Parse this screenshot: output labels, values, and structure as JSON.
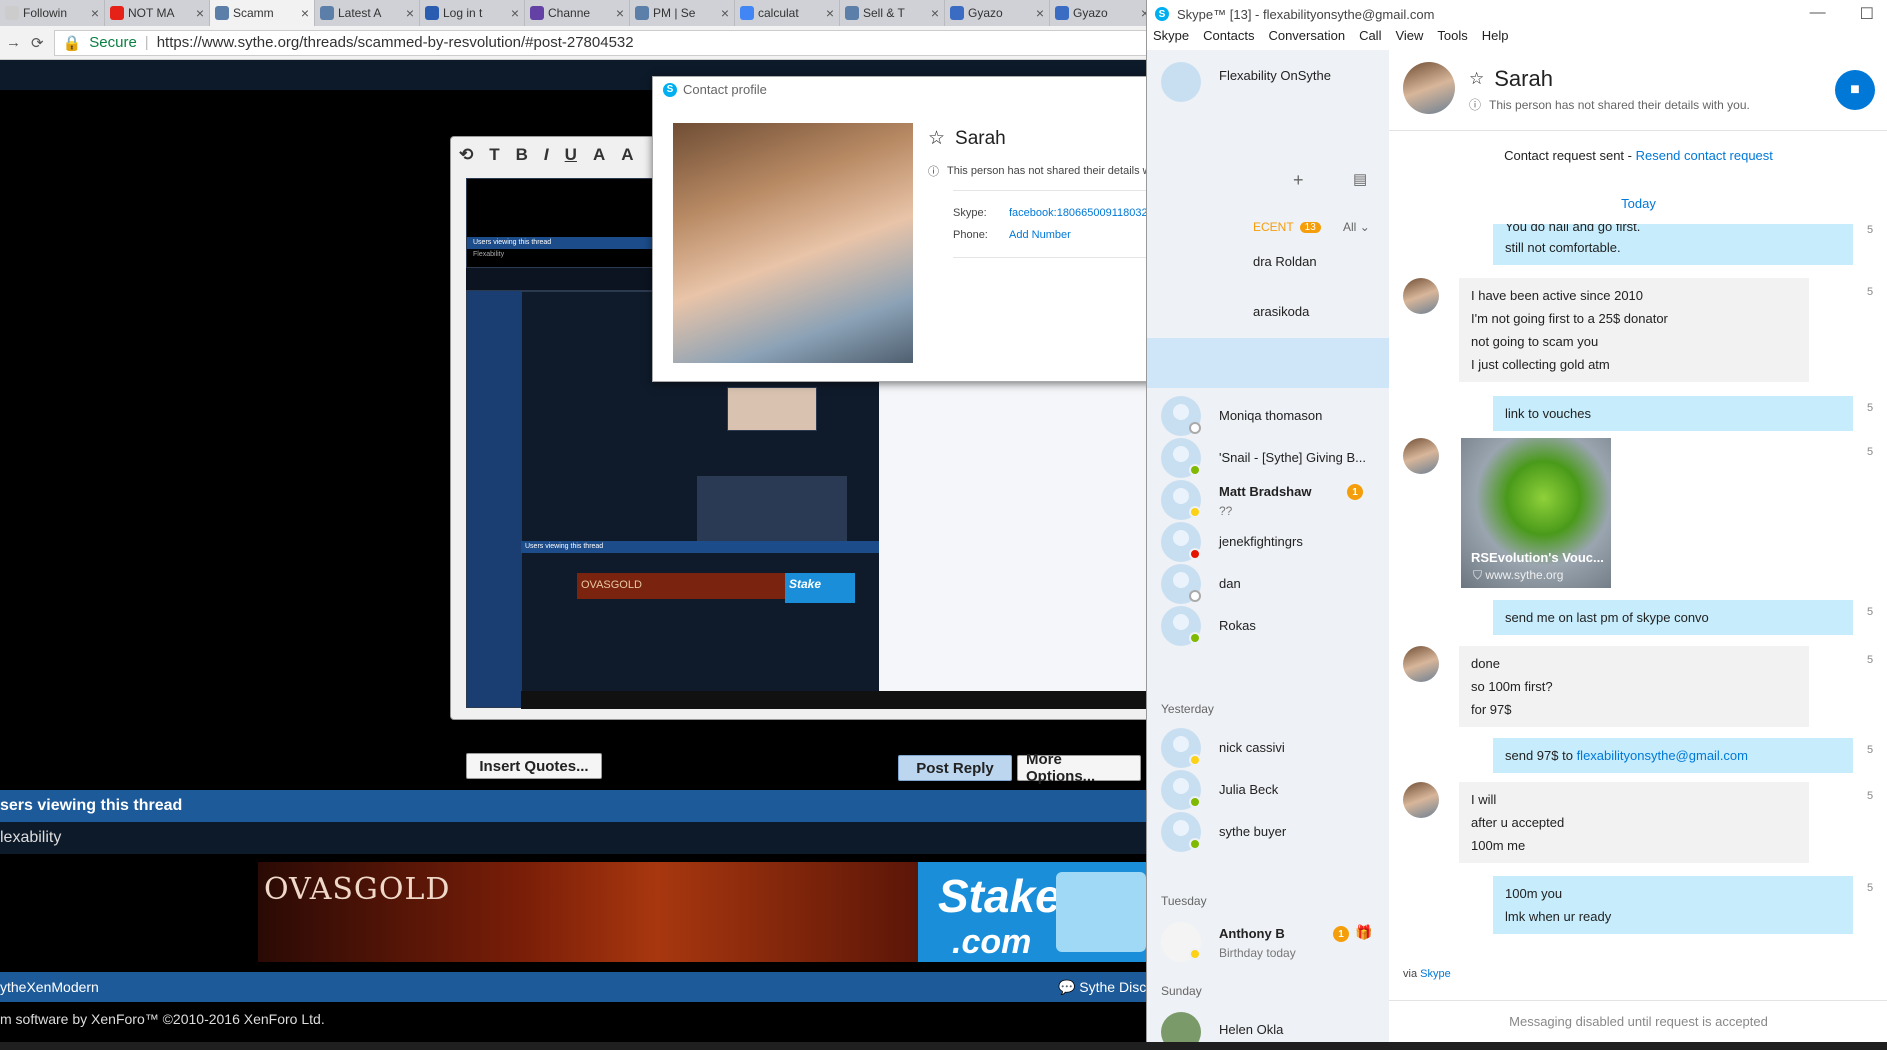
{
  "browser": {
    "tabs": [
      {
        "label": "Followin",
        "color": "#cccccc"
      },
      {
        "label": "NOT MA",
        "color": "#e62117"
      },
      {
        "label": "Scamm",
        "color": "#5b7fa8",
        "active": true
      },
      {
        "label": "Latest A",
        "color": "#5b7fa8"
      },
      {
        "label": "Log in t",
        "color": "#2a5db0"
      },
      {
        "label": "Channe",
        "color": "#6441a5"
      },
      {
        "label": "PM | Se",
        "color": "#5b7fa8"
      },
      {
        "label": "calculat",
        "color": "#4285f4"
      },
      {
        "label": "Sell & T",
        "color": "#5b7fa8"
      },
      {
        "label": "Gyazo",
        "color": "#3a6cc4"
      },
      {
        "label": "Gyazo",
        "color": "#3a6cc4"
      }
    ],
    "secure_label": "Secure",
    "url": "https://www.sythe.org/threads/scammed-by-resvolution/#post-27804532"
  },
  "forum": {
    "insert_quotes": "Insert Quotes...",
    "post_reply": "Post Reply",
    "more_options": "More Options...",
    "viewing_title": "sers viewing this thread",
    "viewers": "lexability",
    "ad_ovas": "OVASGOLD",
    "ad_stake_1": "Stake",
    "ad_stake_2": ".com",
    "footer_left": "ytheXenModern",
    "footer_right": "Sythe Disco",
    "copyright": "m software by XenForo™ ©2010-2016 XenForo Ltd.",
    "nested_viewing": "Users viewing this thread",
    "nested_viewers": "Flexability"
  },
  "profile": {
    "title": "Contact profile",
    "name": "Sarah",
    "notice": "This person has not shared their details with you.",
    "skype_label": "Skype:",
    "skype_value": "facebook:180665009118032",
    "phone_label": "Phone:",
    "phone_value": "Add Number"
  },
  "skype": {
    "title": "Skype™ [13] - flexabilityonsythe@gmail.com",
    "menu": [
      "Skype",
      "Contacts",
      "Conversation",
      "Call",
      "View",
      "Tools",
      "Help"
    ],
    "self_name": "Flexability OnSythe",
    "recent_label": "ECENT",
    "recent_count": "13",
    "all_label": "All",
    "partial_1": "dra Roldan",
    "partial_2": "arasikoda",
    "contacts": [
      {
        "name": "Moniqa thomason",
        "status": "st-off"
      },
      {
        "name": "'Snail - [Sythe] Giving B...",
        "status": "st-on"
      },
      {
        "name": "Matt Bradshaw",
        "sub": "??",
        "status": "st-away",
        "badge": "1"
      },
      {
        "name": "jenekfightingrs",
        "status": "st-busy"
      },
      {
        "name": "dan",
        "status": "st-off"
      },
      {
        "name": "Rokas",
        "status": "st-on"
      }
    ],
    "yesterday": "Yesterday",
    "contacts_yesterday": [
      {
        "name": "nick cassivi",
        "status": "st-away"
      },
      {
        "name": "Julia Beck",
        "status": "st-on"
      },
      {
        "name": "sythe buyer",
        "status": "st-on"
      }
    ],
    "tuesday": "Tuesday",
    "anthony": {
      "name": "Anthony B",
      "sub": "Birthday today",
      "badge": "1"
    },
    "sunday": "Sunday",
    "helen": "Helen Okla",
    "conv": {
      "name": "Sarah",
      "notice": "This person has not shared their details with you.",
      "request_sent": "Contact request sent - ",
      "resend": "Resend contact request",
      "today": "Today",
      "m1": [
        "You do hall and go first.",
        "still not comfortable."
      ],
      "m2": [
        "I have been active since 2010",
        "I'm not going first to a 25$ donator",
        "not going to scam you",
        "I just collecting gold atm"
      ],
      "m3": "link to vouches",
      "card_title": "RSEvolution's Vouc...",
      "card_site": "www.sythe.org",
      "m4": "send me on last pm of skype convo",
      "m5": [
        "done",
        "so 100m first?",
        "for 97$"
      ],
      "m6_pre": "send 97$ to ",
      "m6_link": "flexabilityonsythe@gmail.com",
      "m7": [
        "I will",
        "after u accepted",
        "100m me"
      ],
      "m8": [
        "100m you",
        "lmk when ur ready"
      ],
      "via": "via ",
      "via_link": "Skype",
      "disabled": "Messaging disabled until request is accepted",
      "ts": "5"
    }
  }
}
